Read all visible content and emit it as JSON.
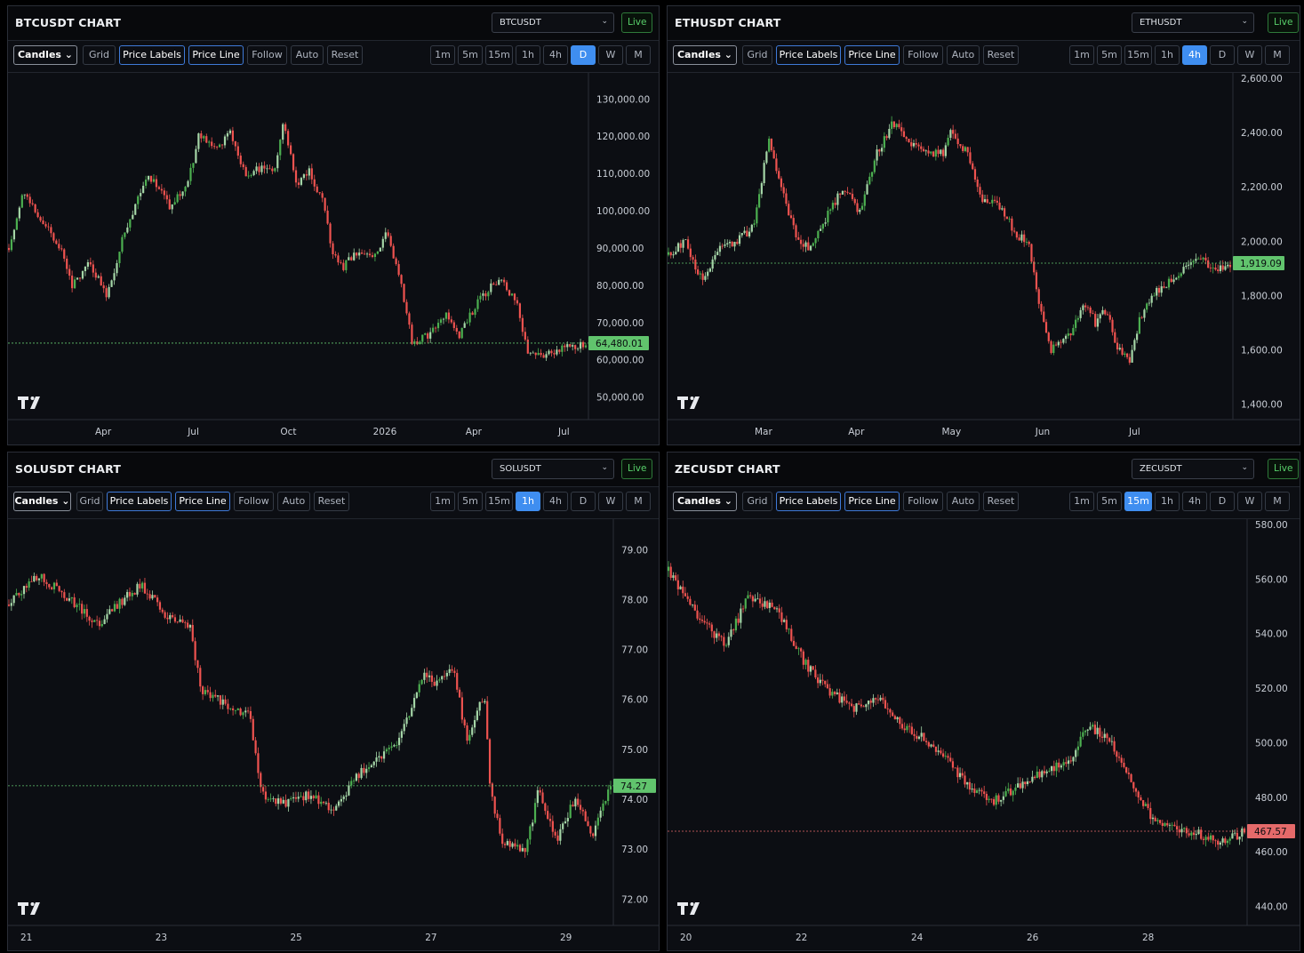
{
  "colors": {
    "up": "#26a69a",
    "up_light": "#a5d6a7",
    "down": "#ef5350",
    "bg": "#0c0e13",
    "price_tag_up": "#61c46d",
    "price_tag_down": "#e56a6a",
    "accent": "#3f8ef0",
    "live": "#58d06a"
  },
  "toolbar": {
    "style_label": "Candles",
    "buttons": [
      "Grid",
      "Price Labels",
      "Price Line",
      "Follow",
      "Auto",
      "Reset"
    ],
    "timeframes": [
      "1m",
      "5m",
      "15m",
      "1h",
      "4h",
      "D",
      "W",
      "M"
    ],
    "live_label": "Live",
    "logo": "TV"
  },
  "panels": [
    {
      "id": "btc",
      "title": "BTCUSDT CHART",
      "symbol": "BTCUSDT",
      "selected_timeframe": "D",
      "chart_data": {
        "type": "candlestick",
        "y_ticks": [
          "130,000.00",
          "120,000.00",
          "110,000.00",
          "100,000.00",
          "90,000.00",
          "80,000.00",
          "70,000.00",
          "60,000.00",
          "50,000.00"
        ],
        "y_tick_values": [
          130000,
          120000,
          110000,
          100000,
          90000,
          80000,
          70000,
          60000,
          50000
        ],
        "x_ticks": [
          "Apr",
          "Jul",
          "Oct",
          "2026",
          "Apr",
          "Jul"
        ],
        "last_price": "64,480.01",
        "last_price_value": 64480.01,
        "direction": "up",
        "path": [
          [
            0,
            90000
          ],
          [
            0.025,
            105000
          ],
          [
            0.06,
            97000
          ],
          [
            0.09,
            90000
          ],
          [
            0.11,
            80000
          ],
          [
            0.14,
            86000
          ],
          [
            0.17,
            77000
          ],
          [
            0.2,
            94000
          ],
          [
            0.24,
            110000
          ],
          [
            0.28,
            101000
          ],
          [
            0.31,
            107000
          ],
          [
            0.33,
            121000
          ],
          [
            0.36,
            116000
          ],
          [
            0.385,
            121000
          ],
          [
            0.41,
            109000
          ],
          [
            0.44,
            112000
          ],
          [
            0.46,
            110000
          ],
          [
            0.475,
            124000
          ],
          [
            0.5,
            107000
          ],
          [
            0.52,
            111000
          ],
          [
            0.545,
            102000
          ],
          [
            0.56,
            89000
          ],
          [
            0.58,
            85000
          ],
          [
            0.6,
            89000
          ],
          [
            0.63,
            87000
          ],
          [
            0.655,
            94000
          ],
          [
            0.675,
            84000
          ],
          [
            0.7,
            64000
          ],
          [
            0.73,
            67000
          ],
          [
            0.76,
            72000
          ],
          [
            0.78,
            66000
          ],
          [
            0.81,
            75000
          ],
          [
            0.85,
            82000
          ],
          [
            0.88,
            75000
          ],
          [
            0.9,
            62000
          ],
          [
            0.93,
            61000
          ],
          [
            0.96,
            63000
          ],
          [
            1.0,
            64480
          ]
        ]
      }
    },
    {
      "id": "eth",
      "title": "ETHUSDT CHART",
      "symbol": "ETHUSDT",
      "selected_timeframe": "4h",
      "chart_data": {
        "type": "candlestick",
        "y_ticks": [
          "2,600.00",
          "2,400.00",
          "2,200.00",
          "2,000.00",
          "1,800.00",
          "1,600.00",
          "1,400.00"
        ],
        "y_tick_values": [
          2600,
          2400,
          2200,
          2000,
          1800,
          1600,
          1400
        ],
        "x_ticks": [
          "Mar",
          "Apr",
          "May",
          "Jun",
          "Jul"
        ],
        "last_price": "1,919.09",
        "last_price_value": 1919.09,
        "direction": "up",
        "path": [
          [
            0,
            1950
          ],
          [
            0.03,
            2000
          ],
          [
            0.06,
            1850
          ],
          [
            0.09,
            1980
          ],
          [
            0.12,
            2000
          ],
          [
            0.15,
            2050
          ],
          [
            0.18,
            2380
          ],
          [
            0.2,
            2200
          ],
          [
            0.23,
            2000
          ],
          [
            0.25,
            1980
          ],
          [
            0.29,
            2120
          ],
          [
            0.31,
            2200
          ],
          [
            0.34,
            2110
          ],
          [
            0.37,
            2320
          ],
          [
            0.4,
            2440
          ],
          [
            0.43,
            2350
          ],
          [
            0.46,
            2330
          ],
          [
            0.49,
            2320
          ],
          [
            0.5,
            2400
          ],
          [
            0.53,
            2330
          ],
          [
            0.56,
            2150
          ],
          [
            0.59,
            2130
          ],
          [
            0.62,
            2020
          ],
          [
            0.64,
            2000
          ],
          [
            0.66,
            1760
          ],
          [
            0.68,
            1600
          ],
          [
            0.7,
            1620
          ],
          [
            0.72,
            1680
          ],
          [
            0.74,
            1780
          ],
          [
            0.76,
            1700
          ],
          [
            0.78,
            1750
          ],
          [
            0.8,
            1600
          ],
          [
            0.82,
            1560
          ],
          [
            0.84,
            1720
          ],
          [
            0.87,
            1820
          ],
          [
            0.9,
            1860
          ],
          [
            0.92,
            1900
          ],
          [
            0.95,
            1940
          ],
          [
            0.97,
            1890
          ],
          [
            1.0,
            1919
          ]
        ]
      }
    },
    {
      "id": "sol",
      "title": "SOLUSDT CHART",
      "symbol": "SOLUSDT",
      "selected_timeframe": "1h",
      "chart_data": {
        "type": "candlestick",
        "y_ticks": [
          "79.00",
          "78.00",
          "77.00",
          "76.00",
          "75.00",
          "74.00",
          "73.00",
          "72.00"
        ],
        "y_tick_values": [
          79,
          78,
          77,
          76,
          75,
          74,
          73,
          72
        ],
        "x_ticks": [
          "21",
          "23",
          "25",
          "27",
          "29"
        ],
        "last_price": "74.27",
        "last_price_value": 74.27,
        "direction": "up",
        "path": [
          [
            0,
            77.9
          ],
          [
            0.05,
            78.5
          ],
          [
            0.1,
            78.0
          ],
          [
            0.15,
            77.5
          ],
          [
            0.19,
            78.0
          ],
          [
            0.22,
            78.3
          ],
          [
            0.26,
            77.7
          ],
          [
            0.3,
            77.5
          ],
          [
            0.32,
            76.2
          ],
          [
            0.36,
            75.9
          ],
          [
            0.4,
            75.7
          ],
          [
            0.42,
            74.1
          ],
          [
            0.46,
            73.9
          ],
          [
            0.5,
            74.1
          ],
          [
            0.54,
            73.8
          ],
          [
            0.58,
            74.5
          ],
          [
            0.62,
            74.9
          ],
          [
            0.65,
            75.2
          ],
          [
            0.69,
            76.6
          ],
          [
            0.71,
            76.3
          ],
          [
            0.74,
            76.6
          ],
          [
            0.76,
            75.2
          ],
          [
            0.79,
            76.1
          ],
          [
            0.8,
            74.2
          ],
          [
            0.82,
            73.1
          ],
          [
            0.86,
            73.0
          ],
          [
            0.88,
            74.2
          ],
          [
            0.91,
            73.2
          ],
          [
            0.94,
            74.0
          ],
          [
            0.97,
            73.3
          ],
          [
            1.0,
            74.27
          ]
        ]
      }
    },
    {
      "id": "zec",
      "title": "ZECUSDT CHART",
      "symbol": "ZECUSDT",
      "selected_timeframe": "15m",
      "chart_data": {
        "type": "candlestick",
        "y_ticks": [
          "580.00",
          "560.00",
          "540.00",
          "520.00",
          "500.00",
          "480.00",
          "460.00",
          "440.00"
        ],
        "y_tick_values": [
          580,
          560,
          540,
          520,
          500,
          480,
          460,
          440
        ],
        "x_ticks": [
          "20",
          "22",
          "24",
          "26",
          "28"
        ],
        "last_price": "467.57",
        "last_price_value": 467.57,
        "direction": "down",
        "path": [
          [
            0,
            563
          ],
          [
            0.05,
            546
          ],
          [
            0.1,
            536
          ],
          [
            0.14,
            554
          ],
          [
            0.19,
            548
          ],
          [
            0.24,
            528
          ],
          [
            0.28,
            519
          ],
          [
            0.32,
            513
          ],
          [
            0.37,
            516
          ],
          [
            0.41,
            506
          ],
          [
            0.46,
            499
          ],
          [
            0.51,
            487
          ],
          [
            0.56,
            478
          ],
          [
            0.6,
            483
          ],
          [
            0.66,
            490
          ],
          [
            0.7,
            494
          ],
          [
            0.73,
            507
          ],
          [
            0.77,
            499
          ],
          [
            0.8,
            488
          ],
          [
            0.84,
            472
          ],
          [
            0.88,
            468
          ],
          [
            0.92,
            467
          ],
          [
            0.96,
            463
          ],
          [
            1.0,
            467.57
          ]
        ]
      }
    }
  ]
}
